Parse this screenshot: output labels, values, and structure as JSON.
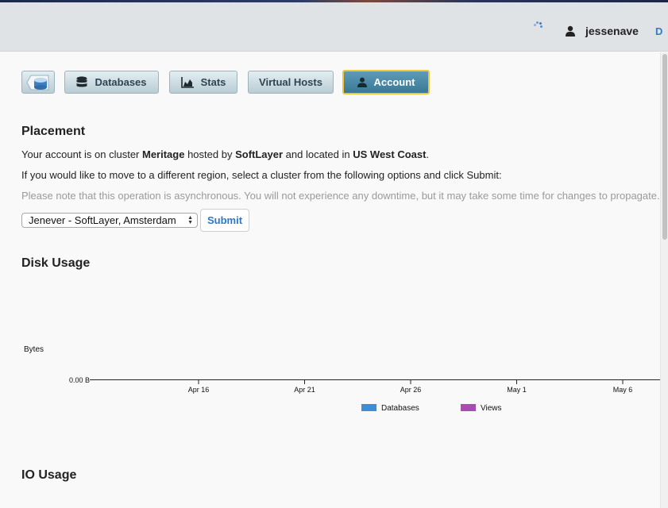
{
  "header": {
    "username": "jessenave",
    "cut_link": "D"
  },
  "nav": {
    "items": [
      {
        "label": "",
        "icon": "cloud-db-icon"
      },
      {
        "label": "Databases",
        "icon": "database-icon"
      },
      {
        "label": "Stats",
        "icon": "area-chart-icon"
      },
      {
        "label": "Virtual Hosts",
        "icon": ""
      },
      {
        "label": "Account",
        "icon": "user-icon",
        "active": true
      }
    ]
  },
  "placement": {
    "title": "Placement",
    "line1": {
      "pre": "Your account is on cluster ",
      "cluster": "Meritage",
      "mid1": " hosted by ",
      "host": "SoftLayer",
      "mid2": " and located in ",
      "location": "US West Coast",
      "post": "."
    },
    "line2": "If you would like to move to a different region, select a cluster from the following options and click Submit:",
    "note": "Please note that this operation is asynchronous. You will not experience any downtime, but it may take some time for changes to propagate.",
    "select_value": "Jenever - SoftLayer, Amsterdam",
    "submit_label": "Submit"
  },
  "disk_usage": {
    "title": "Disk Usage"
  },
  "io_usage": {
    "title": "IO Usage"
  },
  "chart_data": {
    "type": "area",
    "ylabel": "Bytes",
    "y_ticks": [
      "0.00 B"
    ],
    "x_ticks": [
      "Apr 16",
      "Apr 21",
      "Apr 26",
      "May 1",
      "May 6"
    ],
    "series": [
      {
        "name": "Databases",
        "values": [],
        "color": "#3b8fd9"
      },
      {
        "name": "Views",
        "values": [],
        "color": "#a94bb0"
      }
    ],
    "legend": "bottom-center"
  },
  "colors": {
    "accent": "#2d78c4",
    "active_tab": "#4a88a6",
    "active_border": "#f0c537"
  }
}
